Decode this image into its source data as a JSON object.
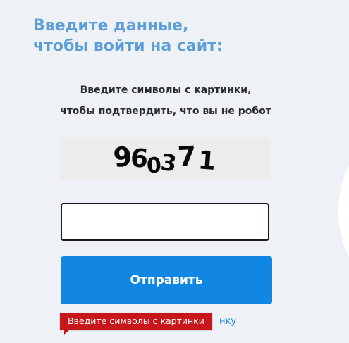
{
  "heading": {
    "line1": "Введите данные,",
    "line2": "чтобы войти на сайт:"
  },
  "instructions": {
    "line1": "Введите символы с картинки,",
    "line2": "чтобы подтвердить, что вы не робот"
  },
  "captcha": {
    "chars": [
      "9",
      "6",
      "0",
      "3",
      "7",
      "1"
    ]
  },
  "form": {
    "input_value": "",
    "submit_label": "Отправить",
    "link_fragment": "нку"
  },
  "error": {
    "message": "Введите символы с картинки"
  },
  "colors": {
    "background": "#eef2f6",
    "heading": "#5d9ed8",
    "button": "#1187e3",
    "error": "#c8161d"
  }
}
